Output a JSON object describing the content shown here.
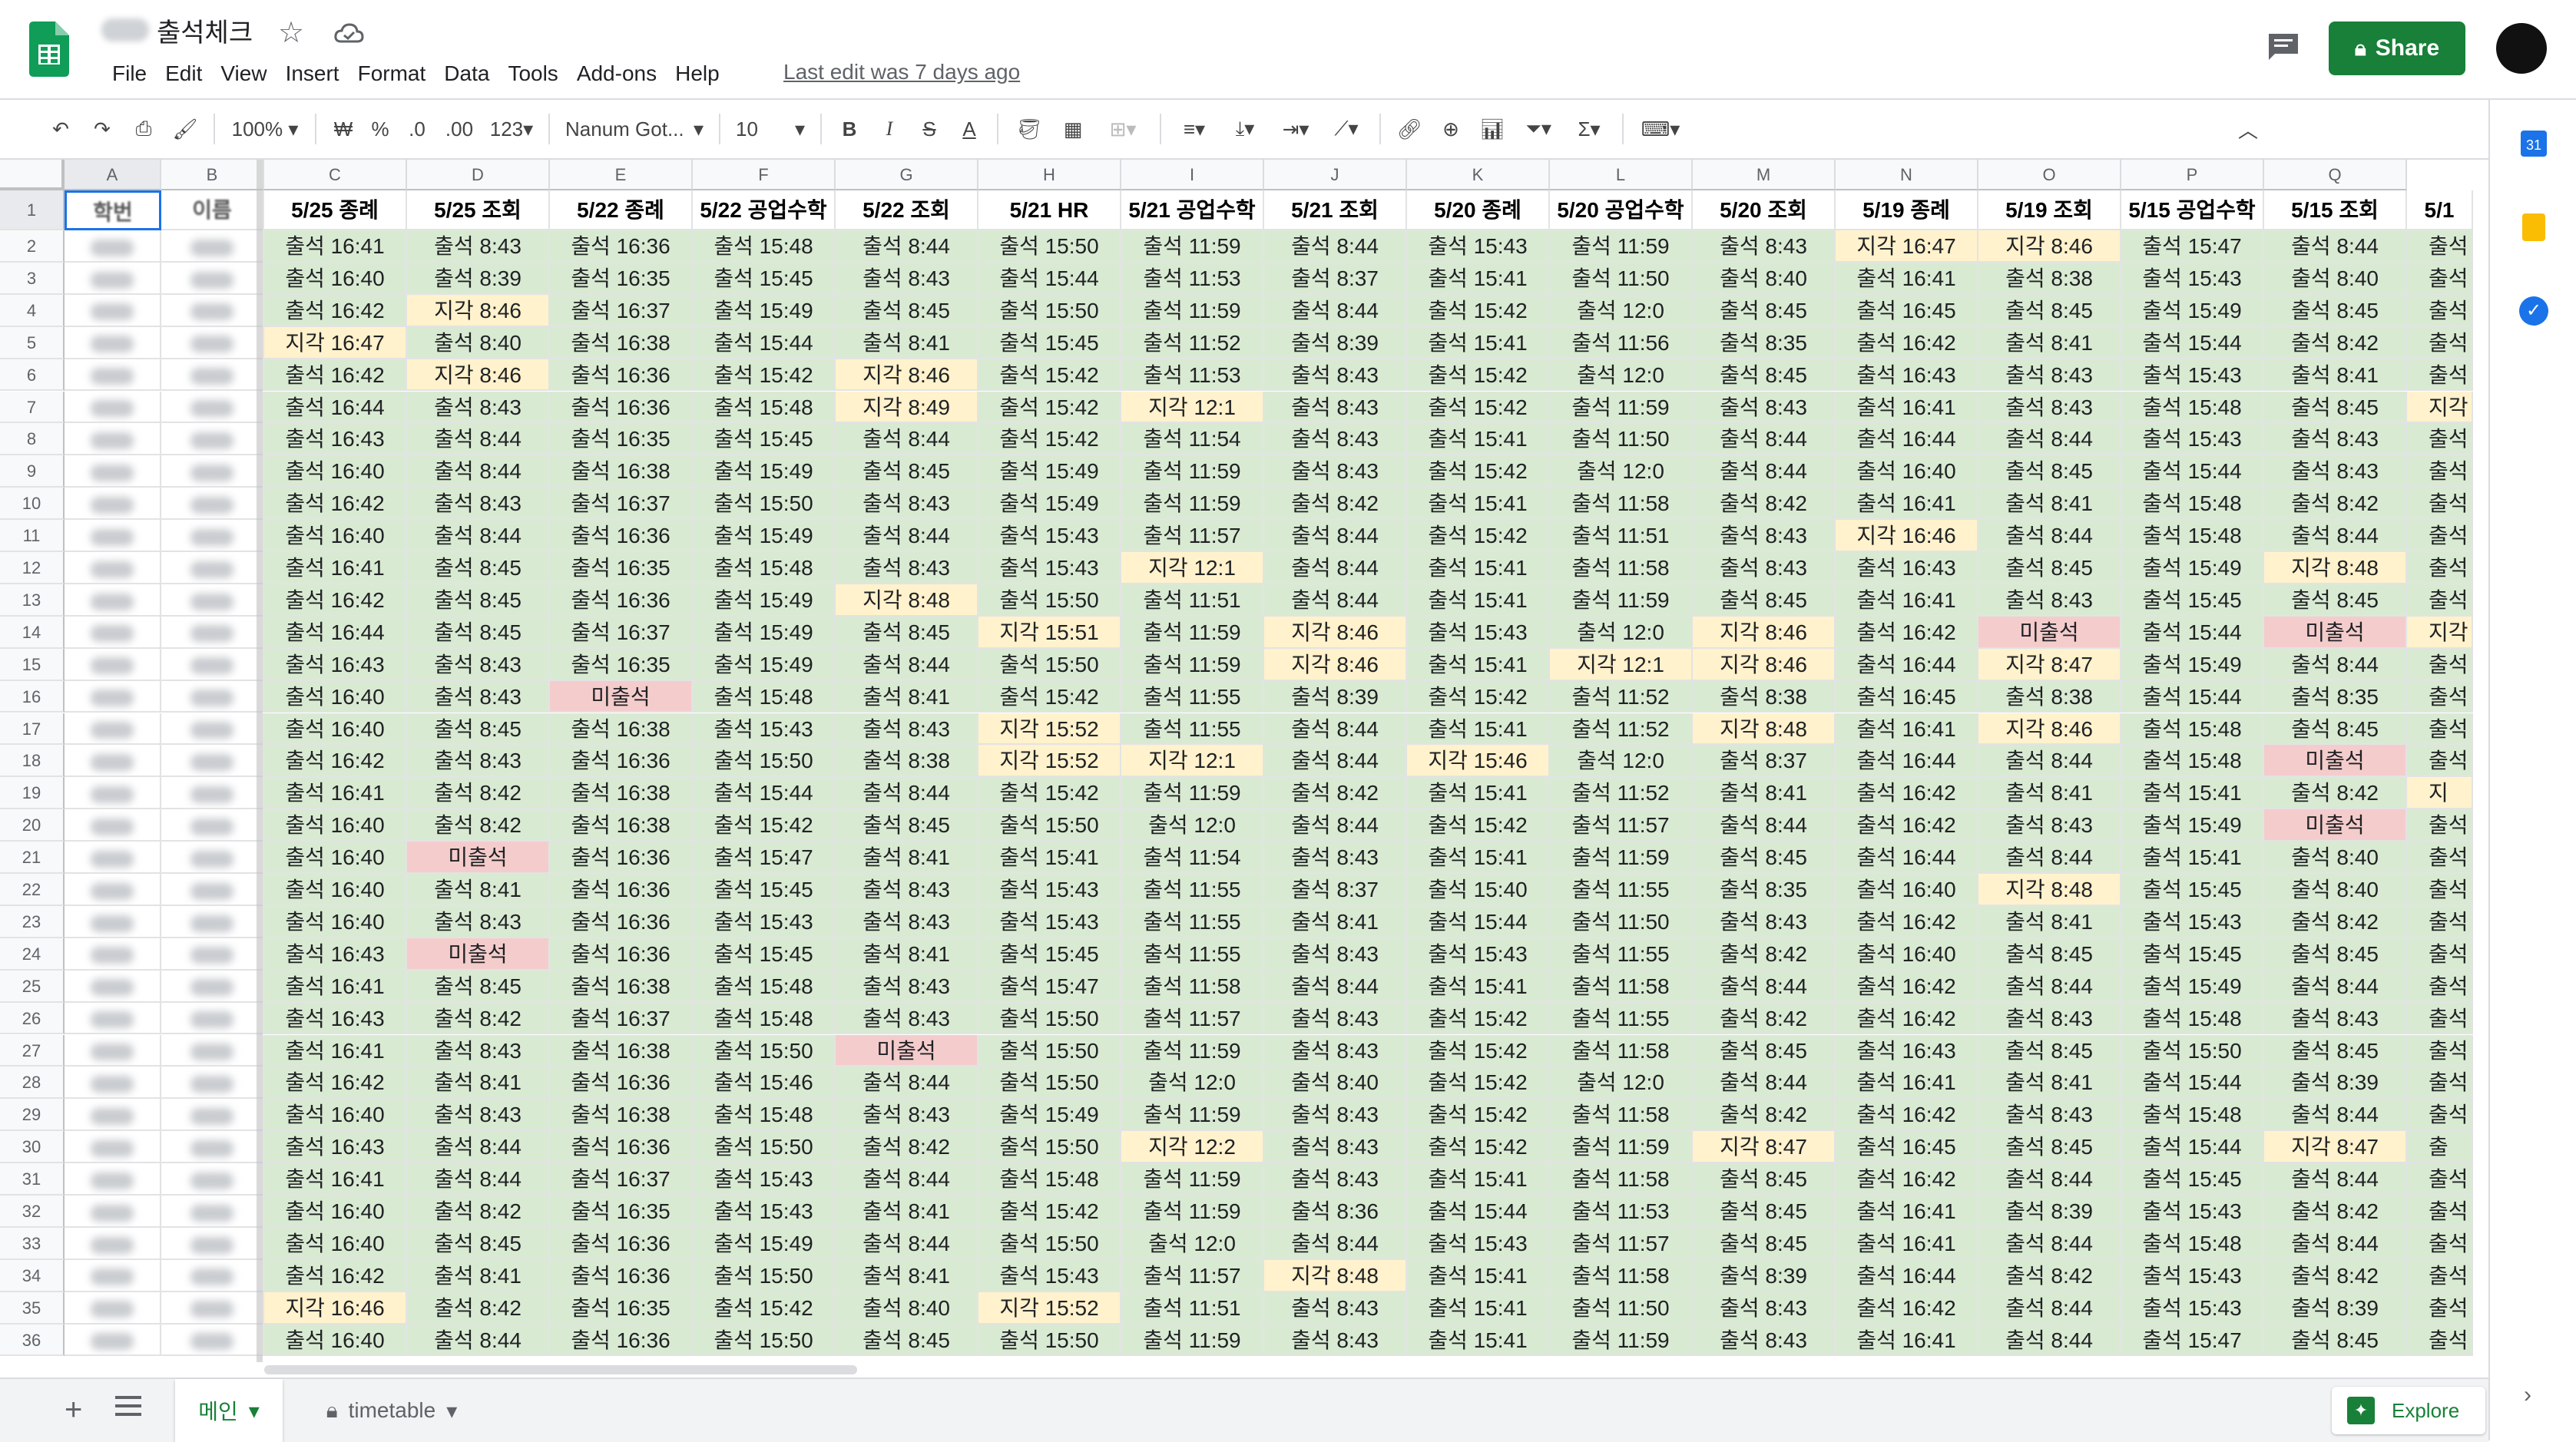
{
  "doc": {
    "title": "출석체크",
    "menu": [
      "File",
      "Edit",
      "View",
      "Insert",
      "Format",
      "Data",
      "Tools",
      "Add-ons",
      "Help"
    ],
    "last_edit": "Last edit was 7 days ago",
    "share_label": "Share"
  },
  "toolbar": {
    "zoom": "100%",
    "currency": "₩",
    "percent": "%",
    "dec_dec": ".0",
    "dec_inc": ".00",
    "more_formats": "123",
    "font": "Nanum Got...",
    "font_size": "10",
    "bold": "B",
    "italic": "I",
    "strike": "S",
    "textcolor": "A"
  },
  "grid": {
    "columns": [
      "A",
      "B",
      "C",
      "D",
      "E",
      "F",
      "G",
      "H",
      "I",
      "J",
      "K",
      "L",
      "M",
      "N",
      "O",
      "P",
      "Q"
    ],
    "frozen_headers": [
      "학번",
      "이름"
    ],
    "headers": [
      "5/25 종례",
      "5/25 조회",
      "5/22 종례",
      "5/22 공업수학",
      "5/22 조회",
      "5/21 HR",
      "5/21 공업수학",
      "5/21 조회",
      "5/20 종례",
      "5/20 공업수학",
      "5/20 조회",
      "5/19 종례",
      "5/19 조회",
      "5/15 공업수학",
      "5/15 조회",
      "5/1"
    ],
    "row_numbers": [
      "1",
      "2",
      "3",
      "4",
      "5",
      "6",
      "7",
      "8",
      "9",
      "10",
      "11",
      "12",
      "13",
      "14",
      "15",
      "16",
      "17",
      "18",
      "19",
      "20",
      "21",
      "22",
      "23",
      "24",
      "25",
      "26",
      "27",
      "28",
      "29",
      "30",
      "31",
      "32",
      "33",
      "34",
      "35",
      "36"
    ],
    "rows": [
      [
        "출석 16:41",
        "출석 8:43",
        "출석 16:36",
        "출석 15:48",
        "출석 8:44",
        "출석 15:50",
        "출석 11:59",
        "출석 8:44",
        "출석 15:43",
        "출석 11:59",
        "출석 8:43",
        "지각 16:47",
        "지각 8:46",
        "출석 15:47",
        "출석 8:44",
        "출석"
      ],
      [
        "출석 16:40",
        "출석 8:39",
        "출석 16:35",
        "출석 15:45",
        "출석 8:43",
        "출석 15:44",
        "출석 11:53",
        "출석 8:37",
        "출석 15:41",
        "출석 11:50",
        "출석 8:40",
        "출석 16:41",
        "출석 8:38",
        "출석 15:43",
        "출석 8:40",
        "출석"
      ],
      [
        "출석 16:42",
        "지각 8:46",
        "출석 16:37",
        "출석 15:49",
        "출석 8:45",
        "출석 15:50",
        "출석 11:59",
        "출석 8:44",
        "출석 15:42",
        "출석 12:0",
        "출석 8:45",
        "출석 16:45",
        "출석 8:45",
        "출석 15:49",
        "출석 8:45",
        "출석"
      ],
      [
        "지각 16:47",
        "출석 8:40",
        "출석 16:38",
        "출석 15:44",
        "출석 8:41",
        "출석 15:45",
        "출석 11:52",
        "출석 8:39",
        "출석 15:41",
        "출석 11:56",
        "출석 8:35",
        "출석 16:42",
        "출석 8:41",
        "출석 15:44",
        "출석 8:42",
        "출석"
      ],
      [
        "출석 16:42",
        "지각 8:46",
        "출석 16:36",
        "출석 15:42",
        "지각 8:46",
        "출석 15:42",
        "출석 11:53",
        "출석 8:43",
        "출석 15:42",
        "출석 12:0",
        "출석 8:45",
        "출석 16:43",
        "출석 8:43",
        "출석 15:43",
        "출석 8:41",
        "출석"
      ],
      [
        "출석 16:44",
        "출석 8:43",
        "출석 16:36",
        "출석 15:48",
        "지각 8:49",
        "출석 15:42",
        "지각 12:1",
        "출석 8:43",
        "출석 15:42",
        "출석 11:59",
        "출석 8:43",
        "출석 16:41",
        "출석 8:43",
        "출석 15:48",
        "출석 8:45",
        "지각"
      ],
      [
        "출석 16:43",
        "출석 8:44",
        "출석 16:35",
        "출석 15:45",
        "출석 8:44",
        "출석 15:42",
        "출석 11:54",
        "출석 8:43",
        "출석 15:41",
        "출석 11:50",
        "출석 8:44",
        "출석 16:44",
        "출석 8:44",
        "출석 15:43",
        "출석 8:43",
        "출석"
      ],
      [
        "출석 16:40",
        "출석 8:44",
        "출석 16:38",
        "출석 15:49",
        "출석 8:45",
        "출석 15:49",
        "출석 11:59",
        "출석 8:43",
        "출석 15:42",
        "출석 12:0",
        "출석 8:44",
        "출석 16:40",
        "출석 8:45",
        "출석 15:44",
        "출석 8:43",
        "출석"
      ],
      [
        "출석 16:42",
        "출석 8:43",
        "출석 16:37",
        "출석 15:50",
        "출석 8:43",
        "출석 15:49",
        "출석 11:59",
        "출석 8:42",
        "출석 15:41",
        "출석 11:58",
        "출석 8:42",
        "출석 16:41",
        "출석 8:41",
        "출석 15:48",
        "출석 8:42",
        "출석"
      ],
      [
        "출석 16:40",
        "출석 8:44",
        "출석 16:36",
        "출석 15:49",
        "출석 8:44",
        "출석 15:43",
        "출석 11:57",
        "출석 8:44",
        "출석 15:42",
        "출석 11:51",
        "출석 8:43",
        "지각 16:46",
        "출석 8:44",
        "출석 15:48",
        "출석 8:44",
        "출석"
      ],
      [
        "출석 16:41",
        "출석 8:45",
        "출석 16:35",
        "출석 15:48",
        "출석 8:43",
        "출석 15:43",
        "지각 12:1",
        "출석 8:44",
        "출석 15:41",
        "출석 11:58",
        "출석 8:43",
        "출석 16:43",
        "출석 8:45",
        "출석 15:49",
        "지각 8:48",
        "출석"
      ],
      [
        "출석 16:42",
        "출석 8:45",
        "출석 16:36",
        "출석 15:49",
        "지각 8:48",
        "출석 15:50",
        "출석 11:51",
        "출석 8:44",
        "출석 15:41",
        "출석 11:59",
        "출석 8:45",
        "출석 16:41",
        "출석 8:43",
        "출석 15:45",
        "출석 8:45",
        "출석"
      ],
      [
        "출석 16:44",
        "출석 8:45",
        "출석 16:37",
        "출석 15:49",
        "출석 8:45",
        "지각 15:51",
        "출석 11:59",
        "지각 8:46",
        "출석 15:43",
        "출석 12:0",
        "지각 8:46",
        "출석 16:42",
        "미출석",
        "출석 15:44",
        "미출석",
        "지각"
      ],
      [
        "출석 16:43",
        "출석 8:43",
        "출석 16:35",
        "출석 15:49",
        "출석 8:44",
        "출석 15:50",
        "출석 11:59",
        "지각 8:46",
        "출석 15:41",
        "지각 12:1",
        "지각 8:46",
        "출석 16:44",
        "지각 8:47",
        "출석 15:49",
        "출석 8:44",
        "출석"
      ],
      [
        "출석 16:40",
        "출석 8:43",
        "미출석",
        "출석 15:48",
        "출석 8:41",
        "출석 15:42",
        "출석 11:55",
        "출석 8:39",
        "출석 15:42",
        "출석 11:52",
        "출석 8:38",
        "출석 16:45",
        "출석 8:38",
        "출석 15:44",
        "출석 8:35",
        "출석"
      ],
      [
        "출석 16:40",
        "출석 8:45",
        "출석 16:38",
        "출석 15:43",
        "출석 8:43",
        "지각 15:52",
        "출석 11:55",
        "출석 8:44",
        "출석 15:41",
        "출석 11:52",
        "지각 8:48",
        "출석 16:41",
        "지각 8:46",
        "출석 15:48",
        "출석 8:45",
        "출석"
      ],
      [
        "출석 16:42",
        "출석 8:43",
        "출석 16:36",
        "출석 15:50",
        "출석 8:38",
        "지각 15:52",
        "지각 12:1",
        "출석 8:44",
        "지각 15:46",
        "출석 12:0",
        "출석 8:37",
        "출석 16:44",
        "출석 8:44",
        "출석 15:48",
        "미출석",
        "출석"
      ],
      [
        "출석 16:41",
        "출석 8:42",
        "출석 16:38",
        "출석 15:44",
        "출석 8:44",
        "출석 15:42",
        "출석 11:59",
        "출석 8:42",
        "출석 15:41",
        "출석 11:52",
        "출석 8:41",
        "출석 16:42",
        "출석 8:41",
        "출석 15:41",
        "출석 8:42",
        "지"
      ],
      [
        "출석 16:40",
        "출석 8:42",
        "출석 16:38",
        "출석 15:42",
        "출석 8:45",
        "출석 15:50",
        "출석 12:0",
        "출석 8:44",
        "출석 15:42",
        "출석 11:57",
        "출석 8:44",
        "출석 16:42",
        "출석 8:43",
        "출석 15:49",
        "미출석",
        "출석"
      ],
      [
        "출석 16:40",
        "미출석",
        "출석 16:36",
        "출석 15:47",
        "출석 8:41",
        "출석 15:41",
        "출석 11:54",
        "출석 8:43",
        "출석 15:41",
        "출석 11:59",
        "출석 8:45",
        "출석 16:44",
        "출석 8:44",
        "출석 15:41",
        "출석 8:40",
        "출석"
      ],
      [
        "출석 16:40",
        "출석 8:41",
        "출석 16:36",
        "출석 15:45",
        "출석 8:43",
        "출석 15:43",
        "출석 11:55",
        "출석 8:37",
        "출석 15:40",
        "출석 11:55",
        "출석 8:35",
        "출석 16:40",
        "지각 8:48",
        "출석 15:45",
        "출석 8:40",
        "출석"
      ],
      [
        "출석 16:40",
        "출석 8:43",
        "출석 16:36",
        "출석 15:43",
        "출석 8:43",
        "출석 15:43",
        "출석 11:55",
        "출석 8:41",
        "출석 15:44",
        "출석 11:50",
        "출석 8:43",
        "출석 16:42",
        "출석 8:41",
        "출석 15:43",
        "출석 8:42",
        "출석"
      ],
      [
        "출석 16:43",
        "미출석",
        "출석 16:36",
        "출석 15:45",
        "출석 8:41",
        "출석 15:45",
        "출석 11:55",
        "출석 8:43",
        "출석 15:43",
        "출석 11:55",
        "출석 8:42",
        "출석 16:40",
        "출석 8:45",
        "출석 15:45",
        "출석 8:45",
        "출석"
      ],
      [
        "출석 16:41",
        "출석 8:45",
        "출석 16:38",
        "출석 15:48",
        "출석 8:43",
        "출석 15:47",
        "출석 11:58",
        "출석 8:44",
        "출석 15:41",
        "출석 11:58",
        "출석 8:44",
        "출석 16:42",
        "출석 8:44",
        "출석 15:49",
        "출석 8:44",
        "출석"
      ],
      [
        "출석 16:43",
        "출석 8:42",
        "출석 16:37",
        "출석 15:48",
        "출석 8:43",
        "출석 15:50",
        "출석 11:57",
        "출석 8:43",
        "출석 15:42",
        "출석 11:55",
        "출석 8:42",
        "출석 16:42",
        "출석 8:43",
        "출석 15:48",
        "출석 8:43",
        "출석"
      ],
      [
        "출석 16:41",
        "출석 8:43",
        "출석 16:38",
        "출석 15:50",
        "미출석",
        "출석 15:50",
        "출석 11:59",
        "출석 8:43",
        "출석 15:42",
        "출석 11:58",
        "출석 8:45",
        "출석 16:43",
        "출석 8:45",
        "출석 15:50",
        "출석 8:45",
        "출석"
      ],
      [
        "출석 16:42",
        "출석 8:41",
        "출석 16:36",
        "출석 15:46",
        "출석 8:44",
        "출석 15:50",
        "출석 12:0",
        "출석 8:40",
        "출석 15:42",
        "출석 12:0",
        "출석 8:44",
        "출석 16:41",
        "출석 8:41",
        "출석 15:44",
        "출석 8:39",
        "출석"
      ],
      [
        "출석 16:40",
        "출석 8:43",
        "출석 16:38",
        "출석 15:48",
        "출석 8:43",
        "출석 15:49",
        "출석 11:59",
        "출석 8:43",
        "출석 15:42",
        "출석 11:58",
        "출석 8:42",
        "출석 16:42",
        "출석 8:43",
        "출석 15:48",
        "출석 8:44",
        "출석"
      ],
      [
        "출석 16:43",
        "출석 8:44",
        "출석 16:36",
        "출석 15:50",
        "출석 8:42",
        "출석 15:50",
        "지각 12:2",
        "출석 8:43",
        "출석 15:42",
        "출석 11:59",
        "지각 8:47",
        "출석 16:45",
        "출석 8:45",
        "출석 15:44",
        "지각 8:47",
        "출"
      ],
      [
        "출석 16:41",
        "출석 8:44",
        "출석 16:37",
        "출석 15:43",
        "출석 8:44",
        "출석 15:48",
        "출석 11:59",
        "출석 8:43",
        "출석 15:41",
        "출석 11:58",
        "출석 8:45",
        "출석 16:42",
        "출석 8:44",
        "출석 15:45",
        "출석 8:44",
        "출석"
      ],
      [
        "출석 16:40",
        "출석 8:42",
        "출석 16:35",
        "출석 15:43",
        "출석 8:41",
        "출석 15:42",
        "출석 11:59",
        "출석 8:36",
        "출석 15:44",
        "출석 11:53",
        "출석 8:45",
        "출석 16:41",
        "출석 8:39",
        "출석 15:43",
        "출석 8:42",
        "출석"
      ],
      [
        "출석 16:40",
        "출석 8:45",
        "출석 16:36",
        "출석 15:49",
        "출석 8:44",
        "출석 15:50",
        "출석 12:0",
        "출석 8:44",
        "출석 15:43",
        "출석 11:57",
        "출석 8:45",
        "출석 16:41",
        "출석 8:44",
        "출석 15:48",
        "출석 8:44",
        "출석"
      ],
      [
        "출석 16:42",
        "출석 8:41",
        "출석 16:36",
        "출석 15:50",
        "출석 8:41",
        "출석 15:43",
        "출석 11:57",
        "지각 8:48",
        "출석 15:41",
        "출석 11:58",
        "출석 8:39",
        "출석 16:44",
        "출석 8:42",
        "출석 15:43",
        "출석 8:42",
        "출석"
      ],
      [
        "지각 16:46",
        "출석 8:42",
        "출석 16:35",
        "출석 15:42",
        "출석 8:40",
        "지각 15:52",
        "출석 11:51",
        "출석 8:43",
        "출석 15:41",
        "출석 11:50",
        "출석 8:43",
        "출석 16:42",
        "출석 8:44",
        "출석 15:43",
        "출석 8:39",
        "출석"
      ],
      [
        "출석 16:40",
        "출석 8:44",
        "출석 16:36",
        "출석 15:50",
        "출석 8:45",
        "출석 15:50",
        "출석 11:59",
        "출석 8:43",
        "출석 15:41",
        "출석 11:59",
        "출석 8:43",
        "출석 16:41",
        "출석 8:44",
        "출석 15:47",
        "출석 8:45",
        "출석"
      ]
    ]
  },
  "sheets": {
    "tab1": "메인",
    "tab2": "timetable"
  },
  "explore_label": "Explore",
  "colors": {
    "present": "#d9ead3",
    "late": "#fff2cc",
    "absent": "#f4cccc",
    "brand": "#188038"
  }
}
